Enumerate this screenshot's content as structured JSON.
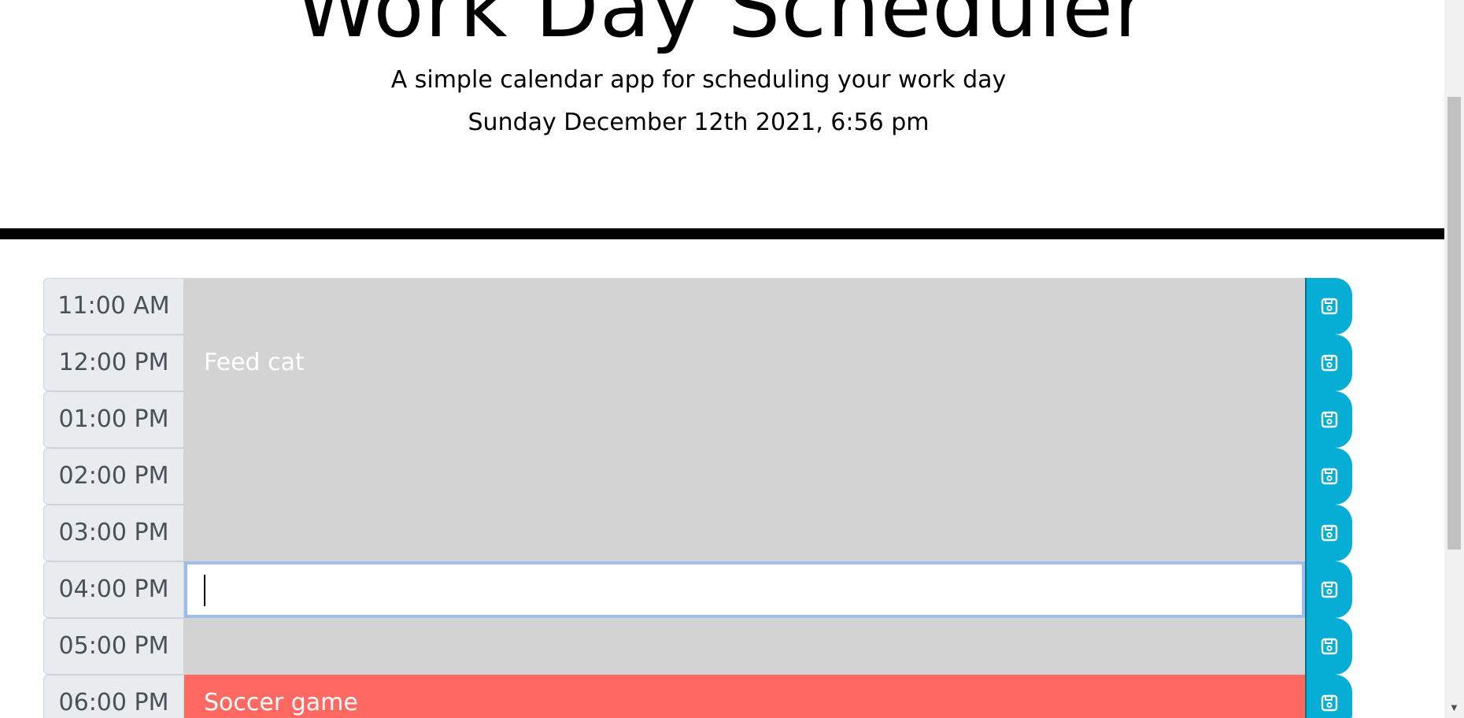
{
  "header": {
    "title": "Work Day Scheduler",
    "subtitle": "A simple calendar app for scheduling your work day",
    "current_date": "Sunday December 12th 2021, 6:56 pm"
  },
  "timeblocks": [
    {
      "hour": "11:00 AM",
      "text": "",
      "state": "past"
    },
    {
      "hour": "12:00 PM",
      "text": "Feed cat",
      "state": "past"
    },
    {
      "hour": "01:00 PM",
      "text": "",
      "state": "past"
    },
    {
      "hour": "02:00 PM",
      "text": "",
      "state": "past"
    },
    {
      "hour": "03:00 PM",
      "text": "",
      "state": "past"
    },
    {
      "hour": "04:00 PM",
      "text": "",
      "state": "present"
    },
    {
      "hour": "05:00 PM",
      "text": "",
      "state": "past"
    },
    {
      "hour": "06:00 PM",
      "text": "Soccer game",
      "state": "future"
    }
  ],
  "icons": {
    "save": "floppy-disk-icon",
    "scroll_down": "scroll-down-arrow-icon"
  },
  "colors": {
    "past": "#d3d3d3",
    "present": "#ffffff",
    "future": "#ff6961",
    "save_button": "#06aed5",
    "hour_background": "#e9ecef"
  }
}
